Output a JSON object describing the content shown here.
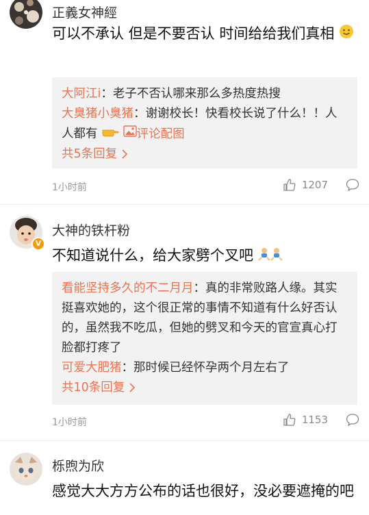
{
  "comments": [
    {
      "username": "正義女神經",
      "content": "可以不承认 但是不要否认 时间给给我们真相",
      "replies": [
        {
          "name": "大阿江i",
          "text": "：老子不否认哪来那么多热度热搜"
        },
        {
          "name": "大臭猪小臭猪",
          "text": "：谢谢校长！快看校长说了什么！！人人都有",
          "tail": "评论配图"
        }
      ],
      "more": "共5条回复",
      "time": "1小时前",
      "likes": "1207"
    },
    {
      "username": "大神的铁杆粉",
      "content": "不知道说什么，给大家劈个叉吧",
      "badge": "V",
      "replies": [
        {
          "name": "看能坚持多久的不二月月",
          "text": "：真的非常败路人缘。其实挺喜欢她的，这个很正常的事情不知道有什么好否认的，虽然我不吃瓜，但她的劈叉和今天的官宣真心打脸都打疼了"
        },
        {
          "name": "可爱大肥猪",
          "text": "：那时候已经怀孕两个月左右了"
        }
      ],
      "more": "共10条回复",
      "time": "1小时前",
      "likes": "1153"
    },
    {
      "username": "栎煦为欣",
      "content": "感觉大大方方公布的话也很好，没必要遮掩的吧"
    }
  ],
  "colors": {
    "accent": "#eb7350",
    "muted": "#999999",
    "reply_bg": "#f2f2f2"
  },
  "icons": [
    "smile-emoji-icon",
    "pointing-hand-icon",
    "image-icon",
    "chevron-right-icon",
    "thumbs-up-icon",
    "comment-bubble-icon",
    "dancing-emoji-icon",
    "verified-badge-icon"
  ]
}
